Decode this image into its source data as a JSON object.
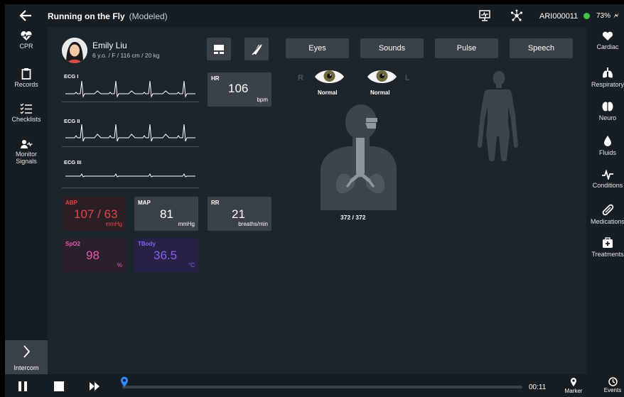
{
  "topbar": {
    "title": "Running on the Fly",
    "mode": "(Modeled)",
    "device_id": "ARI000011",
    "battery": "73%"
  },
  "left_nav": [
    {
      "label": "CPR",
      "icon": "heartbeat-icon"
    },
    {
      "label": "Records",
      "icon": "clipboard-icon"
    },
    {
      "label": "Checklists",
      "icon": "checklist-icon"
    },
    {
      "label": "Monitor Signals",
      "icon": "monitor-signals-icon"
    }
  ],
  "intercom_label": "Intercom",
  "right_nav": [
    {
      "label": "Cardiac",
      "icon": "heart-icon"
    },
    {
      "label": "Respiratory",
      "icon": "lungs-icon"
    },
    {
      "label": "Neuro",
      "icon": "brain-icon"
    },
    {
      "label": "Fluids",
      "icon": "drop-icon"
    },
    {
      "label": "Conditions",
      "icon": "pulse-wave-icon"
    },
    {
      "label": "Medications",
      "icon": "pill-icon"
    },
    {
      "label": "Treatments",
      "icon": "first-aid-kit-icon"
    }
  ],
  "patient": {
    "name": "Emily Liu",
    "info": "6 y.o. / F / 116 cm / 20 kg"
  },
  "ecg_leads": [
    "ECG I",
    "ECG II",
    "ECG III"
  ],
  "vitals": {
    "hr": {
      "label": "HR",
      "value": "106",
      "unit": "bpm"
    },
    "abp": {
      "label": "ABP",
      "value": "107 / 63",
      "unit": "mmHg",
      "color": "#e0474c"
    },
    "map": {
      "label": "MAP",
      "value": "81",
      "unit": "mmHg"
    },
    "rr": {
      "label": "RR",
      "value": "21",
      "unit": "breaths/min"
    },
    "spo2": {
      "label": "SpO2",
      "value": "98",
      "unit": "%",
      "color": "#e35bb3"
    },
    "tbody": {
      "label": "TBody",
      "value": "36.5",
      "unit": "°C",
      "color": "#8c5cf5"
    }
  },
  "tabs": [
    "Eyes",
    "Sounds",
    "Pulse",
    "Speech"
  ],
  "eyes": {
    "right_letter": "R",
    "left_letter": "L",
    "right_status": "Normal",
    "left_status": "Normal"
  },
  "airway_reading": "372 / 372",
  "timeline": {
    "time": "00:11",
    "marker_label": "Marker",
    "events_label": "Events",
    "progress": 0.0
  },
  "colors": {
    "panel": "#1d252c",
    "bar": "#161d23",
    "tile": "#3a4149",
    "ok": "#3ec447"
  }
}
